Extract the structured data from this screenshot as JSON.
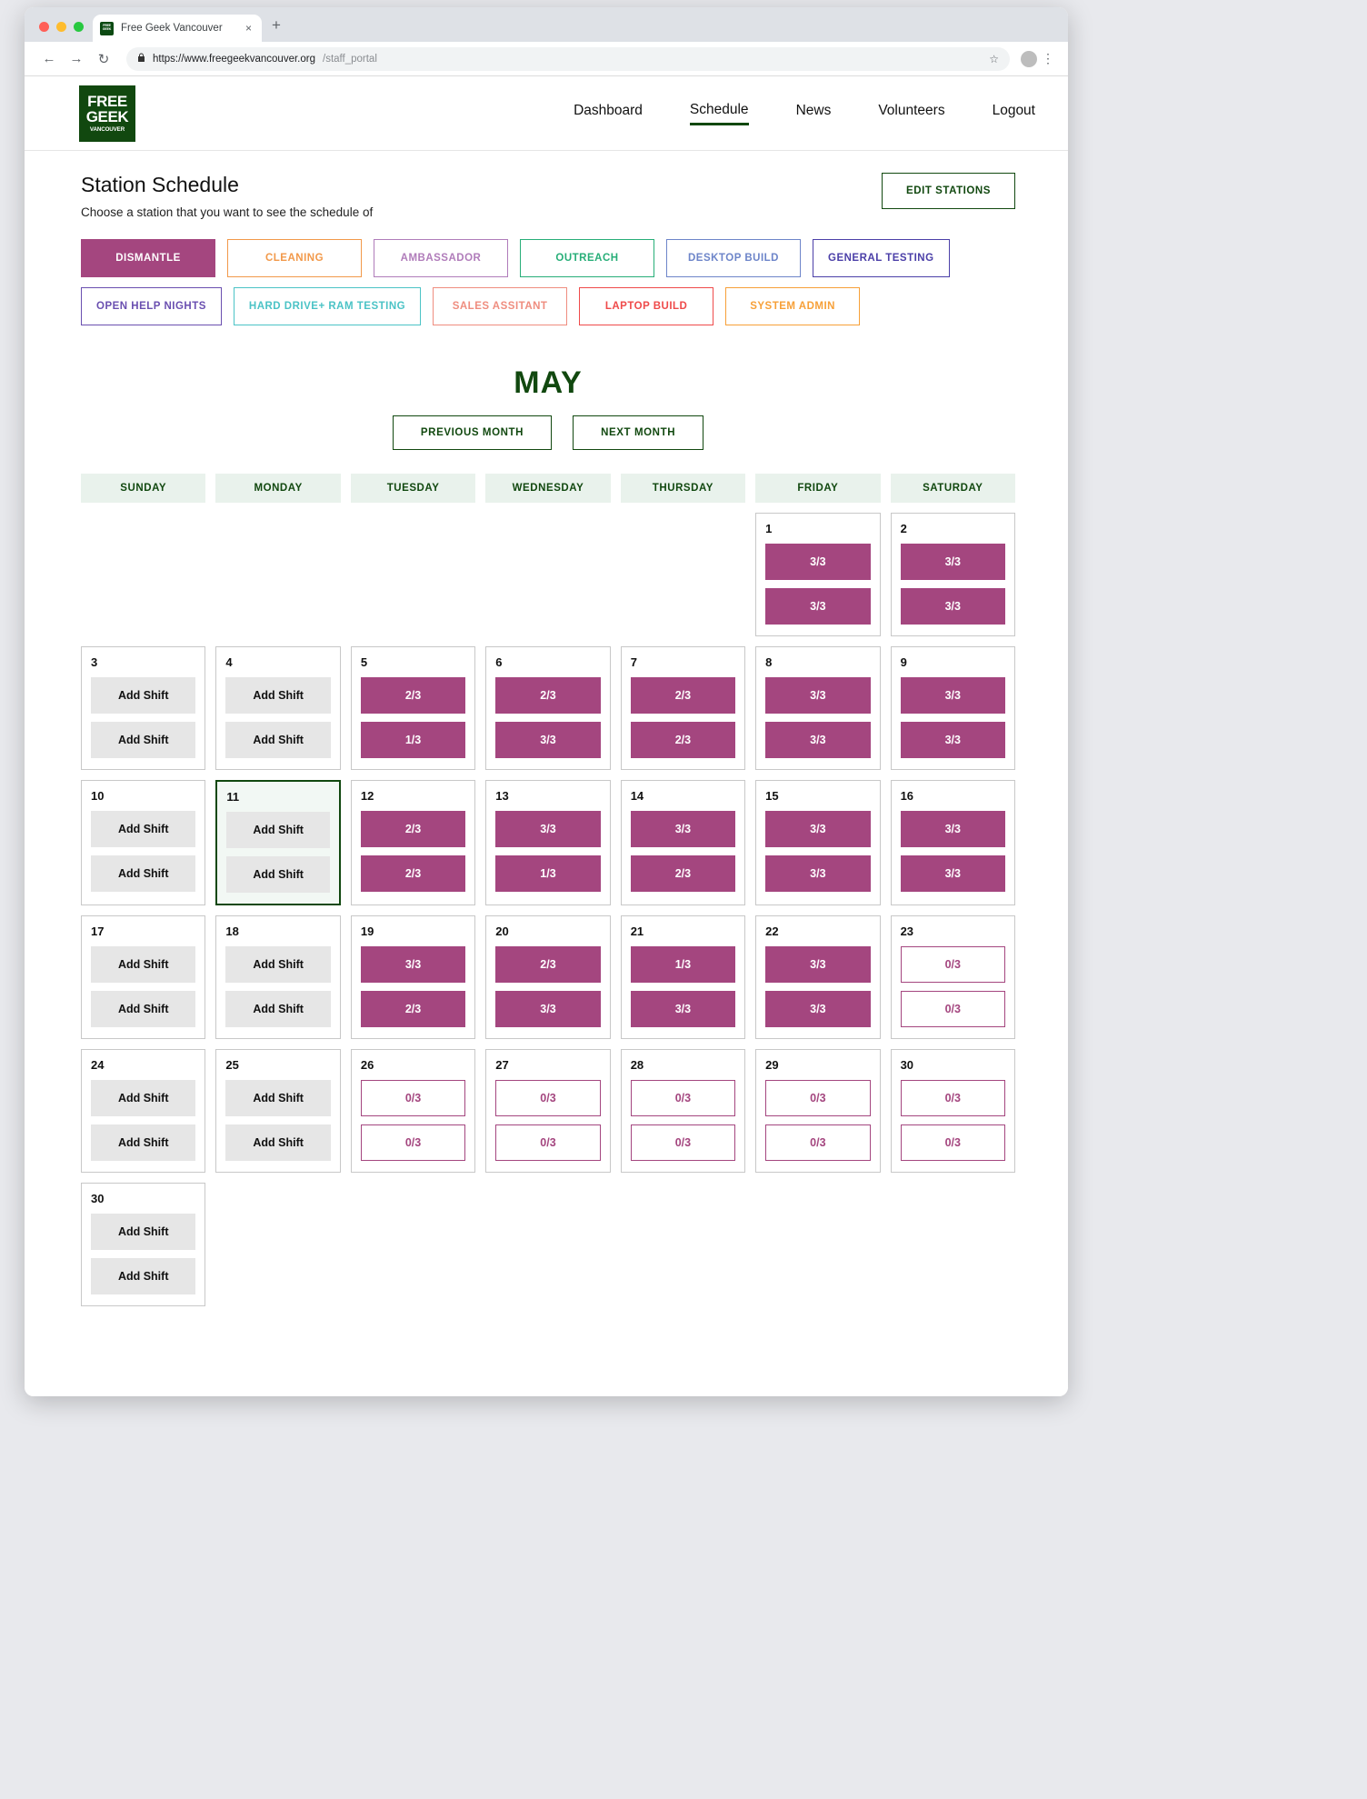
{
  "browser": {
    "tab_title": "Free Geek Vancouver",
    "favicon_lines": [
      "FREE",
      "GEEK",
      "VANCOUVER"
    ],
    "new_tab_label": "+",
    "close_label": "×",
    "back_icon": "←",
    "forward_icon": "→",
    "reload_icon": "↻",
    "lock_icon": "🔒",
    "url_main": "https://www.freegeekvancouver.org",
    "url_path": "/staff_portal",
    "star_icon": "☆",
    "kebab_icon": "⋮"
  },
  "site": {
    "logo": {
      "line1": "FREE",
      "line2": "GEEK",
      "line3": "VANCOUVER",
      "color": "#11480f"
    },
    "nav": [
      {
        "label": "Dashboard",
        "active": false
      },
      {
        "label": "Schedule",
        "active": true
      },
      {
        "label": "News",
        "active": false
      },
      {
        "label": "Volunteers",
        "active": false
      },
      {
        "label": "Logout",
        "active": false
      }
    ]
  },
  "header": {
    "title": "Station Schedule",
    "subtitle": "Choose a station that you want to see the schedule of",
    "edit_stations_label": "EDIT STATIONS"
  },
  "stations": [
    {
      "label": "DISMANTLE",
      "color": "#a4467f",
      "active": true
    },
    {
      "label": "CLEANING",
      "color": "#f2994a",
      "active": false
    },
    {
      "label": "AMBASSADOR",
      "color": "#b07cba",
      "active": false
    },
    {
      "label": "OUTREACH",
      "color": "#27ae78",
      "active": false
    },
    {
      "label": "DESKTOP BUILD",
      "color": "#6d85c9",
      "active": false
    },
    {
      "label": "GENERAL TESTING",
      "color": "#4b3fa8",
      "active": false
    },
    {
      "label": "OPEN HELP NIGHTS",
      "color": "#6a4fb0",
      "active": false
    },
    {
      "label": "HARD DRIVE\n+ RAM TESTING",
      "color": "#4bc3c6",
      "active": false
    },
    {
      "label": "SALES ASSITANT",
      "color": "#ef8d7f",
      "active": false
    },
    {
      "label": "LAPTOP BUILD",
      "color": "#ef4a4a",
      "active": false
    },
    {
      "label": "SYSTEM ADMIN",
      "color": "#f7a038",
      "active": false
    }
  ],
  "calendar": {
    "month": "MAY",
    "prev_label": "PREVIOUS MONTH",
    "next_label": "NEXT MONTH",
    "day_headers": [
      "SUNDAY",
      "MONDAY",
      "TUESDAY",
      "WEDNESDAY",
      "THURSDAY",
      "FRIDAY",
      "SATURDAY"
    ],
    "add_shift_label": "Add Shift",
    "filled_color": "#a4467f",
    "today": 11,
    "weeks": [
      [
        {
          "blank": true
        },
        {
          "blank": true
        },
        {
          "blank": true
        },
        {
          "blank": true
        },
        {
          "blank": true
        },
        {
          "day": "1",
          "shifts": [
            {
              "type": "filled",
              "label": "3/3"
            },
            {
              "type": "filled",
              "label": "3/3"
            }
          ]
        },
        {
          "day": "2",
          "shifts": [
            {
              "type": "filled",
              "label": "3/3"
            },
            {
              "type": "filled",
              "label": "3/3"
            }
          ]
        }
      ],
      [
        {
          "day": "3",
          "shifts": [
            {
              "type": "add",
              "label": "Add Shift"
            },
            {
              "type": "add",
              "label": "Add Shift"
            }
          ]
        },
        {
          "day": "4",
          "shifts": [
            {
              "type": "add",
              "label": "Add Shift"
            },
            {
              "type": "add",
              "label": "Add Shift"
            }
          ]
        },
        {
          "day": "5",
          "shifts": [
            {
              "type": "filled",
              "label": "2/3"
            },
            {
              "type": "filled",
              "label": "1/3"
            }
          ]
        },
        {
          "day": "6",
          "shifts": [
            {
              "type": "filled",
              "label": "2/3"
            },
            {
              "type": "filled",
              "label": "3/3"
            }
          ]
        },
        {
          "day": "7",
          "shifts": [
            {
              "type": "filled",
              "label": "2/3"
            },
            {
              "type": "filled",
              "label": "2/3"
            }
          ]
        },
        {
          "day": "8",
          "shifts": [
            {
              "type": "filled",
              "label": "3/3"
            },
            {
              "type": "filled",
              "label": "3/3"
            }
          ]
        },
        {
          "day": "9",
          "shifts": [
            {
              "type": "filled",
              "label": "3/3"
            },
            {
              "type": "filled",
              "label": "3/3"
            }
          ]
        }
      ],
      [
        {
          "day": "10",
          "shifts": [
            {
              "type": "add",
              "label": "Add Shift"
            },
            {
              "type": "add",
              "label": "Add Shift"
            }
          ]
        },
        {
          "day": "11",
          "today": true,
          "shifts": [
            {
              "type": "add",
              "label": "Add Shift"
            },
            {
              "type": "add",
              "label": "Add Shift"
            }
          ]
        },
        {
          "day": "12",
          "shifts": [
            {
              "type": "filled",
              "label": "2/3"
            },
            {
              "type": "filled",
              "label": "2/3"
            }
          ]
        },
        {
          "day": "13",
          "shifts": [
            {
              "type": "filled",
              "label": "3/3"
            },
            {
              "type": "filled",
              "label": "1/3"
            }
          ]
        },
        {
          "day": "14",
          "shifts": [
            {
              "type": "filled",
              "label": "3/3"
            },
            {
              "type": "filled",
              "label": "2/3"
            }
          ]
        },
        {
          "day": "15",
          "shifts": [
            {
              "type": "filled",
              "label": "3/3"
            },
            {
              "type": "filled",
              "label": "3/3"
            }
          ]
        },
        {
          "day": "16",
          "shifts": [
            {
              "type": "filled",
              "label": "3/3"
            },
            {
              "type": "filled",
              "label": "3/3"
            }
          ]
        }
      ],
      [
        {
          "day": "17",
          "shifts": [
            {
              "type": "add",
              "label": "Add Shift"
            },
            {
              "type": "add",
              "label": "Add Shift"
            }
          ]
        },
        {
          "day": "18",
          "shifts": [
            {
              "type": "add",
              "label": "Add Shift"
            },
            {
              "type": "add",
              "label": "Add Shift"
            }
          ]
        },
        {
          "day": "19",
          "shifts": [
            {
              "type": "filled",
              "label": "3/3"
            },
            {
              "type": "filled",
              "label": "2/3"
            }
          ]
        },
        {
          "day": "20",
          "shifts": [
            {
              "type": "filled",
              "label": "2/3"
            },
            {
              "type": "filled",
              "label": "3/3"
            }
          ]
        },
        {
          "day": "21",
          "shifts": [
            {
              "type": "filled",
              "label": "1/3"
            },
            {
              "type": "filled",
              "label": "3/3"
            }
          ]
        },
        {
          "day": "22",
          "shifts": [
            {
              "type": "filled",
              "label": "3/3"
            },
            {
              "type": "filled",
              "label": "3/3"
            }
          ]
        },
        {
          "day": "23",
          "shifts": [
            {
              "type": "open",
              "label": "0/3"
            },
            {
              "type": "open",
              "label": "0/3"
            }
          ]
        }
      ],
      [
        {
          "day": "24",
          "shifts": [
            {
              "type": "add",
              "label": "Add Shift"
            },
            {
              "type": "add",
              "label": "Add Shift"
            }
          ]
        },
        {
          "day": "25",
          "shifts": [
            {
              "type": "add",
              "label": "Add Shift"
            },
            {
              "type": "add",
              "label": "Add Shift"
            }
          ]
        },
        {
          "day": "26",
          "shifts": [
            {
              "type": "open",
              "label": "0/3"
            },
            {
              "type": "open",
              "label": "0/3"
            }
          ]
        },
        {
          "day": "27",
          "shifts": [
            {
              "type": "open",
              "label": "0/3"
            },
            {
              "type": "open",
              "label": "0/3"
            }
          ]
        },
        {
          "day": "28",
          "shifts": [
            {
              "type": "open",
              "label": "0/3"
            },
            {
              "type": "open",
              "label": "0/3"
            }
          ]
        },
        {
          "day": "29",
          "shifts": [
            {
              "type": "open",
              "label": "0/3"
            },
            {
              "type": "open",
              "label": "0/3"
            }
          ]
        },
        {
          "day": "30",
          "shifts": [
            {
              "type": "open",
              "label": "0/3"
            },
            {
              "type": "open",
              "label": "0/3"
            }
          ]
        }
      ],
      [
        {
          "day": "30",
          "shifts": [
            {
              "type": "add",
              "label": "Add Shift"
            },
            {
              "type": "add",
              "label": "Add Shift"
            }
          ]
        },
        {
          "blank": true
        },
        {
          "blank": true
        },
        {
          "blank": true
        },
        {
          "blank": true
        },
        {
          "blank": true
        },
        {
          "blank": true
        }
      ]
    ]
  }
}
